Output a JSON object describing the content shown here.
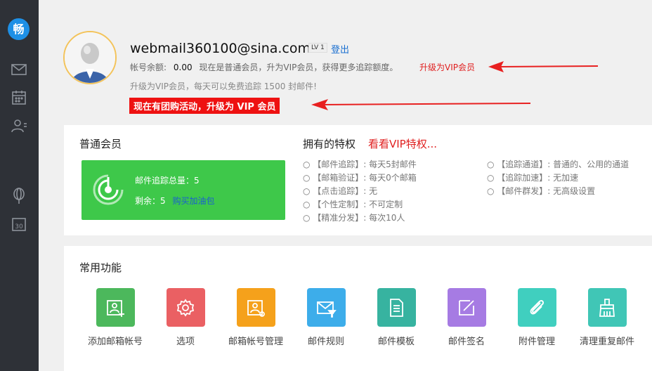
{
  "sidebar": {
    "logo_text": "畅",
    "icons": [
      "mail-icon",
      "calendar-icon",
      "contacts-icon",
      "balloon-icon",
      "date-30-icon"
    ]
  },
  "profile": {
    "email": "webmail360100@sina.com",
    "level": "LV 1",
    "login_label": "登出",
    "balance_label": "帐号余额:",
    "balance_value": "0.00",
    "member_text": "现在是普通会员，升为VIP会员，获得更多追踪额度。",
    "upgrade_link": "升级为VIP会员",
    "vip_note": "升级为VIP会员，每天可以免费追踪 1500 封邮件!",
    "promo_text": "现在有团购活动，升级为 VIP 会员"
  },
  "membership": {
    "title": "普通会员",
    "total_label": "邮件追踪总量：5",
    "remain_label": "剩余：5",
    "buy_link": "购买加油包"
  },
  "privileges": {
    "title": "拥有的特权",
    "link": "看看VIP特权...",
    "left": [
      "○ 【邮件追踪】: 每天5封邮件",
      "○ 【邮箱验证】: 每天0个邮箱",
      "○ 【点击追踪】: 无",
      "○ 【个性定制】: 不可定制",
      "○ 【精准分发】: 每次10人"
    ],
    "right": [
      "○ 【追踪通道】: 普通的、公用的通道",
      "○ 【追踪加速】: 无加速",
      "○ 【邮件群发】: 无高级设置"
    ]
  },
  "functions": {
    "title": "常用功能",
    "items": [
      {
        "label": "添加邮箱帐号",
        "color": "#4cb85c",
        "icon": "add-account-icon"
      },
      {
        "label": "选项",
        "color": "#ea6063",
        "icon": "gear-icon"
      },
      {
        "label": "邮箱帐号管理",
        "color": "#f5a11b",
        "icon": "account-settings-icon"
      },
      {
        "label": "邮件规则",
        "color": "#3dadea",
        "icon": "mail-filter-icon"
      },
      {
        "label": "邮件模板",
        "color": "#37b3a0",
        "icon": "document-icon"
      },
      {
        "label": "邮件签名",
        "color": "#a67be3",
        "icon": "pen-icon"
      },
      {
        "label": "附件管理",
        "color": "#40cfbf",
        "icon": "paperclip-icon"
      },
      {
        "label": "清理重复邮件",
        "color": "#40c6b6",
        "icon": "broom-icon"
      }
    ]
  }
}
